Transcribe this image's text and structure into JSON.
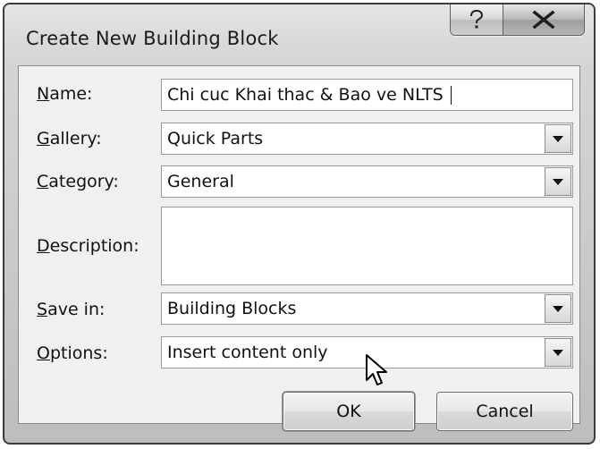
{
  "dialog": {
    "title": "Create New Building Block",
    "help_icon": "question-mark-icon",
    "close_icon": "close-x-icon"
  },
  "form": {
    "name": {
      "label_mnemonic": "N",
      "label_rest": "ame:",
      "value": "Chi cuc Khai thac & Bao ve NLTS "
    },
    "gallery": {
      "label_mnemonic": "G",
      "label_rest": "allery:",
      "value": "Quick Parts"
    },
    "category": {
      "label_mnemonic": "C",
      "label_rest": "ategory:",
      "value": "General"
    },
    "description": {
      "label_mnemonic": "D",
      "label_rest": "escription:",
      "value": ""
    },
    "save_in": {
      "label_mnemonic": "S",
      "label_rest": "ave in:",
      "value": "Building Blocks"
    },
    "options": {
      "label_mnemonic": "O",
      "label_rest": "ptions:",
      "value": "Insert content only"
    }
  },
  "buttons": {
    "ok": "OK",
    "cancel": "Cancel"
  },
  "colors": {
    "frame": "#3c3c3c",
    "panel": "#f0f0f0",
    "title_bg": "#d3d3d3"
  },
  "cursor_icon": "arrow-pointer-icon"
}
